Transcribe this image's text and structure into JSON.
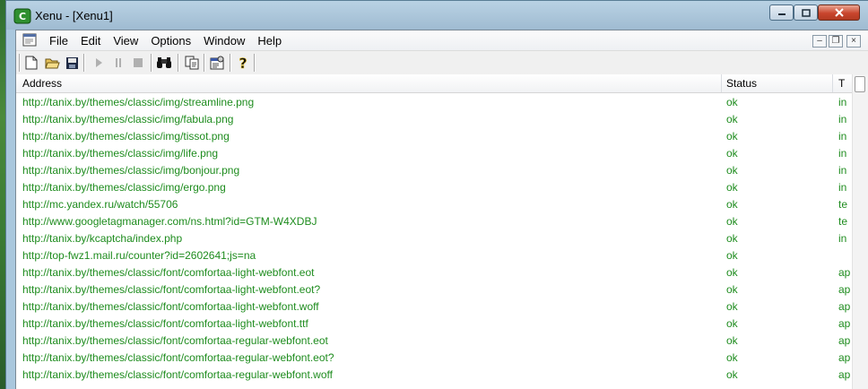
{
  "window": {
    "title": "Xenu - [Xenu1]",
    "controls": {
      "minimize": "minimize-icon",
      "maximize": "maximize-icon",
      "close": "close-icon"
    }
  },
  "menu": {
    "items": [
      "File",
      "Edit",
      "View",
      "Options",
      "Window",
      "Help"
    ]
  },
  "toolbar": {
    "icons": [
      "new-document-icon",
      "open-folder-icon",
      "save-icon",
      "play-icon",
      "pause-icon",
      "stop-icon",
      "binoculars-icon",
      "copy-icon",
      "properties-icon",
      "help-icon"
    ]
  },
  "list": {
    "columns": [
      "Address",
      "Status",
      "T"
    ],
    "rows": [
      {
        "address": "http://tanix.by/themes/classic/img/streamline.png",
        "status": "ok",
        "type": "in"
      },
      {
        "address": "http://tanix.by/themes/classic/img/fabula.png",
        "status": "ok",
        "type": "in"
      },
      {
        "address": "http://tanix.by/themes/classic/img/tissot.png",
        "status": "ok",
        "type": "in"
      },
      {
        "address": "http://tanix.by/themes/classic/img/life.png",
        "status": "ok",
        "type": "in"
      },
      {
        "address": "http://tanix.by/themes/classic/img/bonjour.png",
        "status": "ok",
        "type": "in"
      },
      {
        "address": "http://tanix.by/themes/classic/img/ergo.png",
        "status": "ok",
        "type": "in"
      },
      {
        "address": "http://mc.yandex.ru/watch/55706",
        "status": "ok",
        "type": "te"
      },
      {
        "address": "http://www.googletagmanager.com/ns.html?id=GTM-W4XDBJ",
        "status": "ok",
        "type": "te"
      },
      {
        "address": "http://tanix.by/kcaptcha/index.php",
        "status": "ok",
        "type": "in"
      },
      {
        "address": "http://top-fwz1.mail.ru/counter?id=2602641;js=na",
        "status": "ok",
        "type": ""
      },
      {
        "address": "http://tanix.by/themes/classic/font/comfortaa-light-webfont.eot",
        "status": "ok",
        "type": "ap"
      },
      {
        "address": "http://tanix.by/themes/classic/font/comfortaa-light-webfont.eot?",
        "status": "ok",
        "type": "ap"
      },
      {
        "address": "http://tanix.by/themes/classic/font/comfortaa-light-webfont.woff",
        "status": "ok",
        "type": "ap"
      },
      {
        "address": "http://tanix.by/themes/classic/font/comfortaa-light-webfont.ttf",
        "status": "ok",
        "type": "ap"
      },
      {
        "address": "http://tanix.by/themes/classic/font/comfortaa-regular-webfont.eot",
        "status": "ok",
        "type": "ap"
      },
      {
        "address": "http://tanix.by/themes/classic/font/comfortaa-regular-webfont.eot?",
        "status": "ok",
        "type": "ap"
      },
      {
        "address": "http://tanix.by/themes/classic/font/comfortaa-regular-webfont.woff",
        "status": "ok",
        "type": "ap"
      }
    ]
  },
  "colors": {
    "ok_text": "#1e8c1e"
  }
}
